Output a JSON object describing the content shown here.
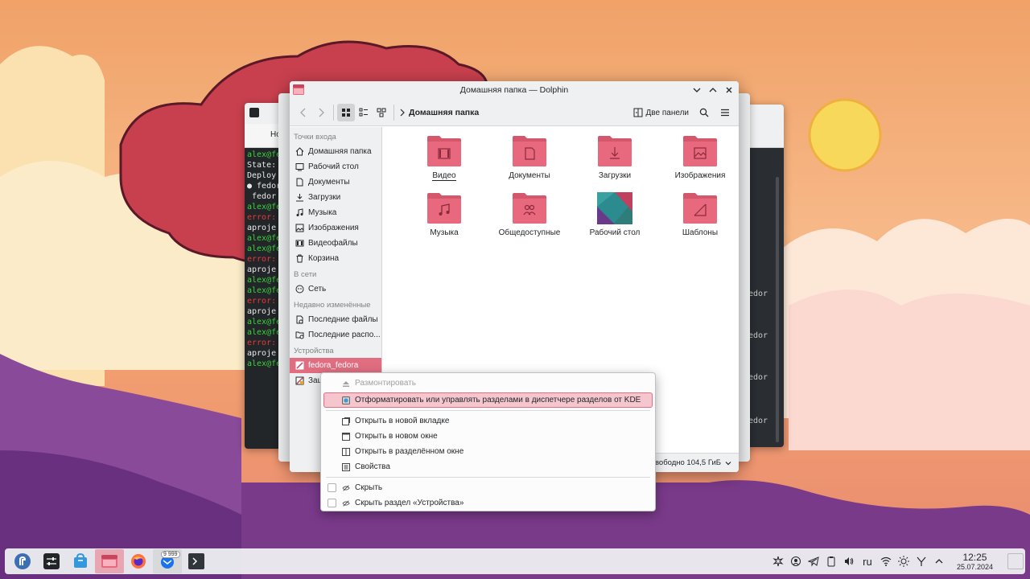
{
  "window": {
    "title": "Домашняя папка — Dolphin",
    "buttons": [
      "minimize",
      "maximize",
      "close"
    ]
  },
  "toolbar": {
    "breadcrumb": "Домашняя папка",
    "split_label": "Две панели"
  },
  "places": {
    "sections": [
      {
        "header": "Точки входа",
        "items": [
          {
            "label": "Домашняя папка",
            "icon": "home-icon"
          },
          {
            "label": "Рабочий стол",
            "icon": "desktop-icon"
          },
          {
            "label": "Документы",
            "icon": "documents-icon"
          },
          {
            "label": "Загрузки",
            "icon": "downloads-icon"
          },
          {
            "label": "Музыка",
            "icon": "music-icon"
          },
          {
            "label": "Изображения",
            "icon": "pictures-icon"
          },
          {
            "label": "Видеофайлы",
            "icon": "videos-icon"
          },
          {
            "label": "Корзина",
            "icon": "trash-icon"
          }
        ]
      },
      {
        "header": "В сети",
        "items": [
          {
            "label": "Сеть",
            "icon": "network-icon"
          }
        ]
      },
      {
        "header": "Недавно изменённые",
        "items": [
          {
            "label": "Последние файлы",
            "icon": "recent-files-icon"
          },
          {
            "label": "Последние распо...",
            "icon": "recent-locations-icon"
          }
        ]
      },
      {
        "header": "Устройства",
        "items": [
          {
            "label": "fedora_fedora",
            "icon": "drive-icon"
          },
          {
            "label": "Защ",
            "icon": "encrypted-drive-icon"
          }
        ]
      }
    ]
  },
  "files": [
    {
      "name": "Видео",
      "icon": "video-folder-icon"
    },
    {
      "name": "Документы",
      "icon": "documents-folder-icon"
    },
    {
      "name": "Загрузки",
      "icon": "downloads-folder-icon"
    },
    {
      "name": "Изображения",
      "icon": "pictures-folder-icon"
    },
    {
      "name": "Музыка",
      "icon": "music-folder-icon"
    },
    {
      "name": "Общедоступные",
      "icon": "public-folder-icon"
    },
    {
      "name": "Рабочий стол",
      "icon": "desktop-folder-icon"
    },
    {
      "name": "Шаблоны",
      "icon": "templates-folder-icon"
    }
  ],
  "status": {
    "free_space": "свободно 104,5 ГиБ"
  },
  "context_menu": {
    "items": [
      {
        "label": "Размонтировать",
        "icon": "eject-icon",
        "disabled": true
      },
      {
        "label": "Отформатировать или управлять разделами в диспетчере разделов от KDE",
        "icon": "partition-manager-icon",
        "highlight": true
      },
      {
        "label": "Открыть в новой вкладке",
        "icon": "new-tab-icon"
      },
      {
        "label": "Открыть в новом окне",
        "icon": "new-window-icon"
      },
      {
        "label": "Открыть в разделённом окне",
        "icon": "split-window-icon"
      },
      {
        "label": "Свойства",
        "icon": "properties-icon"
      },
      {
        "label": "Скрыть",
        "icon": "hide-icon",
        "checkbox": true
      },
      {
        "label": "Скрыть раздел «Устройства»",
        "icon": "hide-section-icon",
        "checkbox": true
      }
    ]
  },
  "terminal": {
    "tab_label": "Но",
    "lines": [
      "alex@fe",
      "State:",
      "Deploy",
      "● fedor",
      "",
      "",
      "",
      " fedor",
      "",
      "",
      "",
      "",
      "alex@fe",
      "error:",
      "aproje",
      "alex@fe",
      "alex@fe",
      "error:",
      "aproje",
      "alex@fe",
      "alex@fe",
      "error:",
      "aproje",
      "alex@fe",
      "alex@fe",
      "error:",
      "aproje",
      "alex@fe"
    ]
  },
  "right_window": {
    "lines": [
      "edor",
      "edor",
      "edor",
      "edor"
    ]
  },
  "taskbar": {
    "badge": "9 999",
    "keyboard_layout": "ru",
    "time": "12:25",
    "date": "25.07.2024"
  },
  "colors": {
    "accent": "#e06e80",
    "folder": "#e8697e",
    "folder_tab": "#d4576c"
  }
}
